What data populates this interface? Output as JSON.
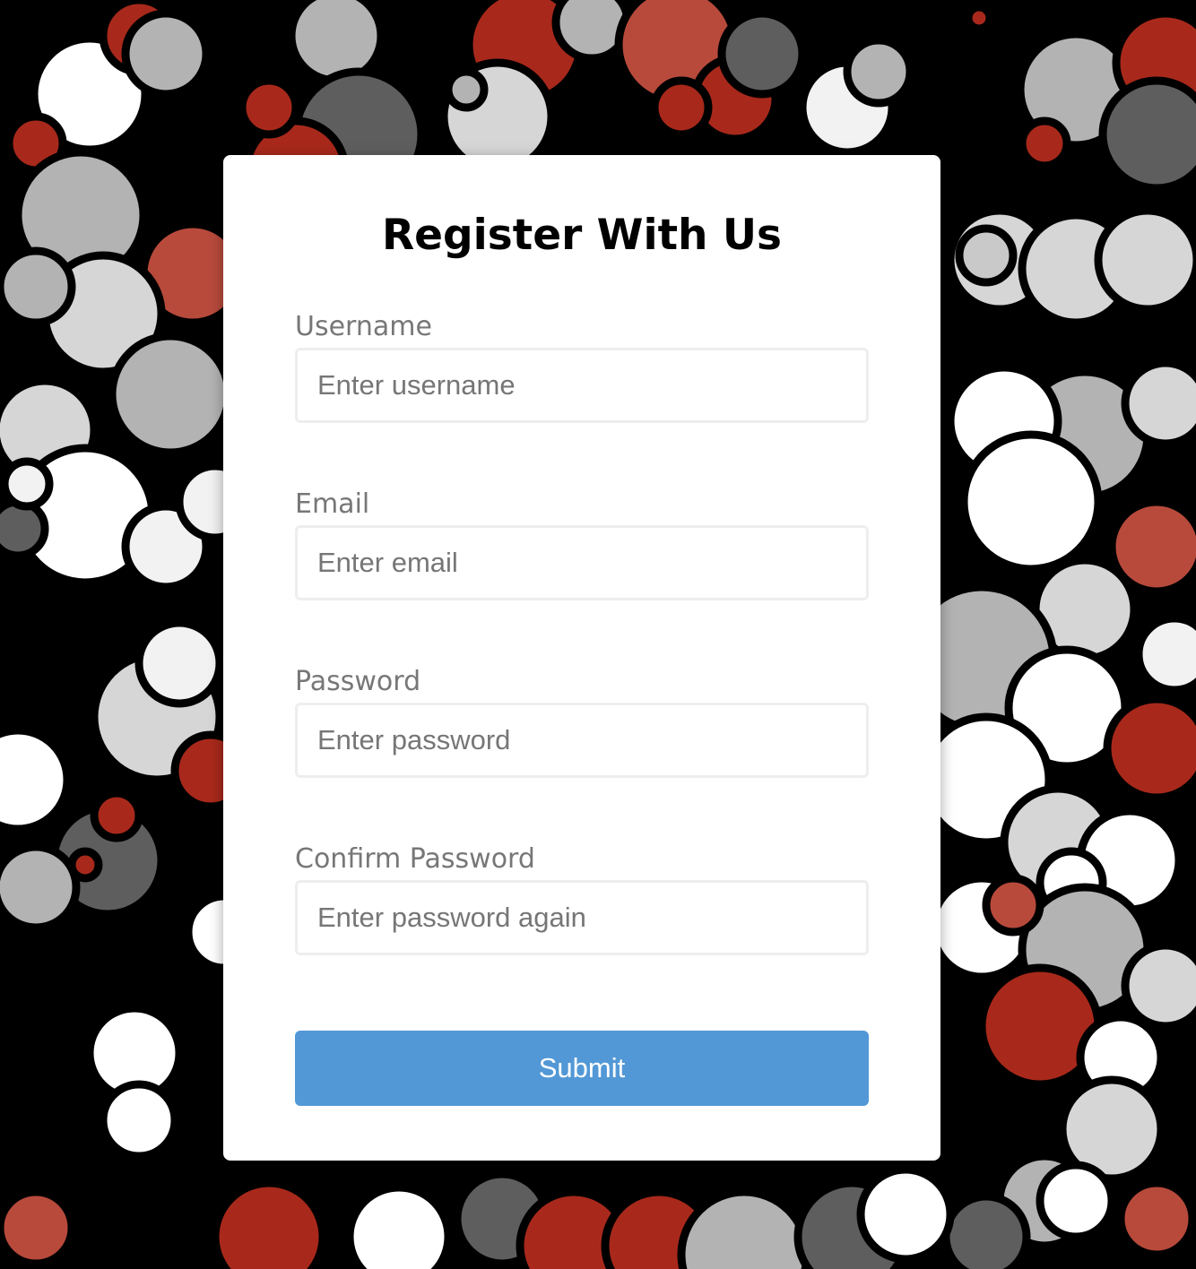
{
  "form": {
    "title": "Register With Us",
    "fields": [
      {
        "label": "Username",
        "placeholder": "Enter username"
      },
      {
        "label": "Email",
        "placeholder": "Enter email"
      },
      {
        "label": "Password",
        "placeholder": "Enter password"
      },
      {
        "label": "Confirm Password",
        "placeholder": "Enter password again"
      }
    ],
    "submit_label": "Submit"
  },
  "colors": {
    "background": "#000000",
    "card": "#ffffff",
    "button": "#5398d6",
    "label_text": "#777777",
    "bubble_red": "#a8291b",
    "bubble_grey": "#b3b3b3",
    "bubble_white": "#f2f2f2"
  }
}
